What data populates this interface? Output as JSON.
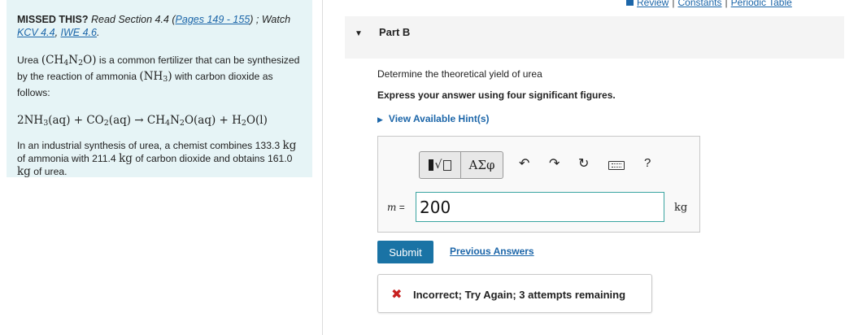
{
  "header_links": [
    "Review",
    "Constants",
    "Periodic Table"
  ],
  "header_sep": "|",
  "problem": {
    "missed_label": "MISSED THIS?",
    "read_text": " Read Section 4.4 (",
    "pages_link": "Pages 149 - 155",
    "watch_text": ") ; Watch",
    "kcv_link": "KCV 4.4",
    "comma": ", ",
    "iwe_link": "IWE 4.6",
    "period": ".",
    "intro": {
      "p1": "Urea ",
      "urea_formula": [
        "CH",
        "4",
        "N",
        "2",
        "O"
      ],
      "p2": " is a common fertilizer that can be synthesized by the reaction of ammonia ",
      "ammonia_formula": [
        "NH",
        "3"
      ],
      "p3": " with carbon dioxide as follows:"
    },
    "equation": [
      "2NH",
      "3",
      "(aq) + CO",
      "2",
      "(aq) → CH",
      "4",
      "N",
      "2",
      "O(aq) + H",
      "2",
      "O(l)"
    ],
    "synthesis": {
      "s1": "In an industrial synthesis of urea, a chemist combines 133.3 ",
      "u1": "kg",
      "s2": " of ammonia with 211.4 ",
      "u2": "kg",
      "s3": " of carbon dioxide and obtains 161.0 ",
      "u3": "kg",
      "s4": " of urea."
    }
  },
  "part": {
    "title": "Part B",
    "question": "Determine the theoretical yield of urea",
    "instruction": "Express your answer using four significant figures.",
    "hints_label": "View Available Hint(s)"
  },
  "toolbar": {
    "greek_label": "ΑΣφ",
    "undo_glyph": "↶",
    "redo_glyph": "↷",
    "reset_glyph": "↻",
    "help_label": "?"
  },
  "answer": {
    "variable": "m",
    "equals": " = ",
    "value": "200",
    "unit": "kg"
  },
  "submit_label": "Submit",
  "previous_answers_label": "Previous Answers",
  "feedback": {
    "icon": "✖",
    "text": "Incorrect; Try Again; 3 attempts remaining"
  },
  "icons": [
    "templates-icon",
    "greek-symbols-icon",
    "undo-icon",
    "redo-icon",
    "reset-icon",
    "keyboard-icon",
    "help-icon",
    "collapse-triangle-icon",
    "incorrect-x-icon"
  ],
  "colors": {
    "link": "#1c66a9",
    "panel_bg": "#e6f4f6",
    "submit_bg": "#1a73a5",
    "error": "#c8201f",
    "input_border": "#3aa4a1"
  }
}
